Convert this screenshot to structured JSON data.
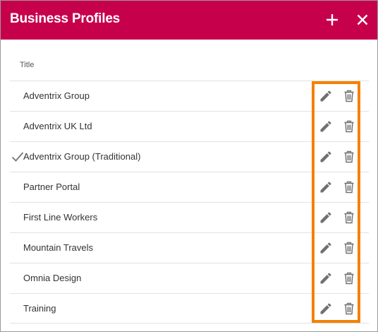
{
  "dialog": {
    "title": "Business Profiles",
    "header_color": "#c7004c",
    "add_icon": "plus-icon",
    "close_icon": "close-icon"
  },
  "table": {
    "column_header": "Title",
    "rows": [
      {
        "label": "Adventrix Group",
        "selected": false
      },
      {
        "label": "Adventrix UK Ltd",
        "selected": false
      },
      {
        "label": "Adventrix Group (Traditional)",
        "selected": true
      },
      {
        "label": "Partner Portal",
        "selected": false
      },
      {
        "label": "First Line Workers",
        "selected": false
      },
      {
        "label": "Mountain Travels",
        "selected": false
      },
      {
        "label": "Omnia Design",
        "selected": false
      },
      {
        "label": "Training",
        "selected": false
      }
    ],
    "row_actions": [
      "pencil-icon",
      "trash-icon"
    ]
  },
  "annotation": {
    "highlight_color": "#f58000"
  }
}
